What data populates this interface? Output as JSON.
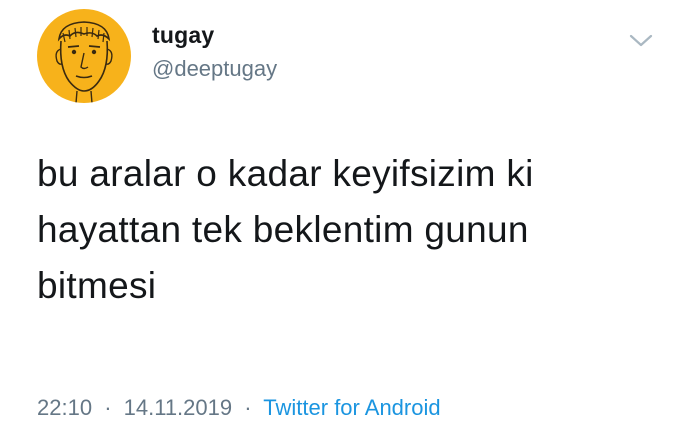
{
  "user": {
    "display_name": "tugay",
    "handle": "@deeptugay"
  },
  "tweet": {
    "text": "bu aralar o kadar keyifsizim ki hayattan tek beklentim gunun bitmesi",
    "time": "22:10",
    "date": "14.11.2019",
    "separator": "·",
    "source": "Twitter for Android"
  },
  "icons": {
    "avatar": "cartoon-face-avatar",
    "menu": "chevron-down-icon"
  },
  "colors": {
    "avatar_background": "#f7b21b",
    "name": "#14171a",
    "secondary": "#657786",
    "link": "#1b95e0"
  }
}
